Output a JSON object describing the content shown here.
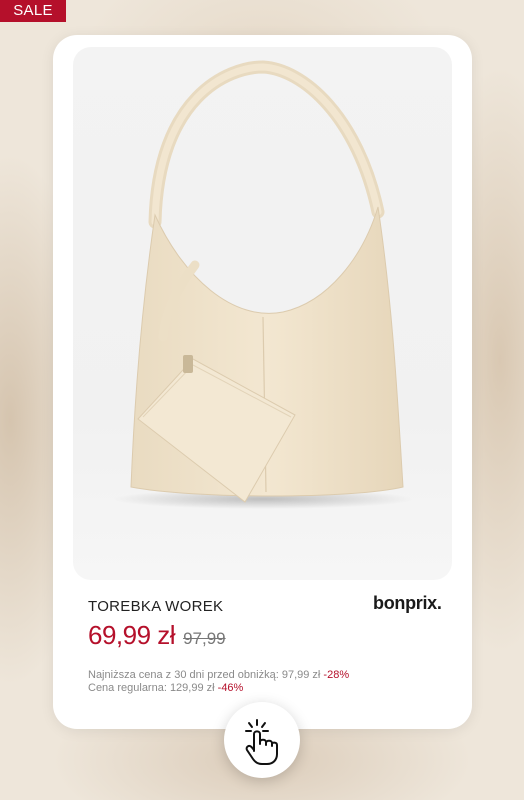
{
  "badge": {
    "label": "SALE"
  },
  "product": {
    "title": "TOREBKA WOREK",
    "brand": "bonprix.",
    "price": "69,99 zł",
    "old_price": "97,99",
    "lowest_price_label": "Najniższa cena z 30 dni przed obniżką: 97,99 zł",
    "lowest_price_discount": "-28%",
    "regular_price_label": "Cena regularna: 129,99 zł",
    "regular_price_discount": "-46%"
  },
  "colors": {
    "accent": "#b5102b",
    "bag": "#f0e3cb"
  },
  "icons": {
    "tap": "hand-tap-icon"
  }
}
